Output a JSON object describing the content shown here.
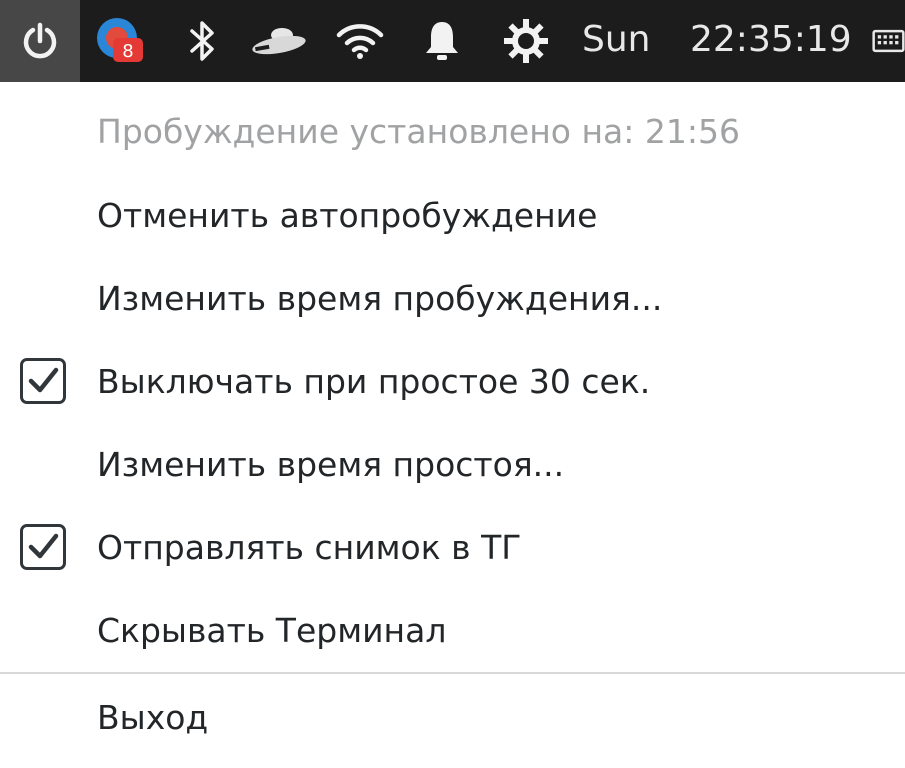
{
  "panel": {
    "day": "Sun",
    "time": "22:35:19",
    "badge_count": "8",
    "icons": [
      "power-icon",
      "app-badge-icon",
      "bluetooth-icon",
      "ufo-icon",
      "wifi-icon",
      "bell-icon",
      "settings-gear-icon",
      "keyboard-icon"
    ],
    "active_bg": "#474747",
    "panel_bg": "#1c1c1c"
  },
  "menu": {
    "status_text": "Пробуждение установлено на: 21:56",
    "items": [
      {
        "label": "Отменить автопробуждение"
      },
      {
        "label": "Изменить время пробуждения..."
      },
      {
        "label": "Выключать при простое 30 сек.",
        "checked": true
      },
      {
        "label": "Изменить время простоя..."
      },
      {
        "label": "Отправлять снимок в ТГ",
        "checked": true
      },
      {
        "label": "Скрывать Терминал"
      }
    ],
    "exit_label": "Выход"
  }
}
